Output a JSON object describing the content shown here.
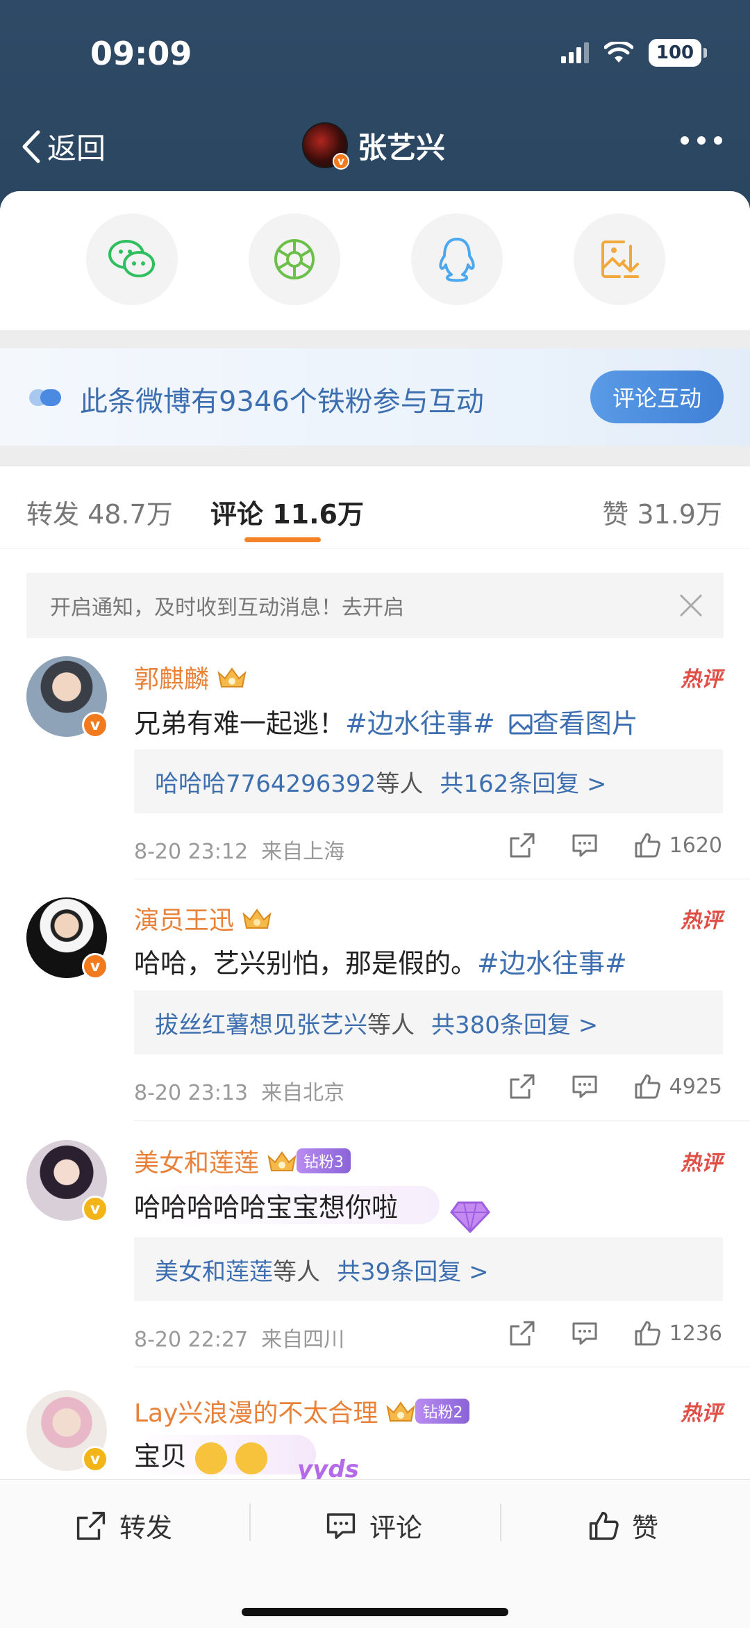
{
  "status_bar": {
    "time": "09:09",
    "battery": "100"
  },
  "nav": {
    "back_label": "返回",
    "title": "张艺兴"
  },
  "share_sheet": {
    "icons": [
      "wechat-icon",
      "moments-icon",
      "qq-icon",
      "save-image-icon"
    ]
  },
  "banner": {
    "text": "此条微博有9346个铁粉参与互动",
    "button": "评论互动"
  },
  "tabs": {
    "repost": "转发 48.7万",
    "comment": "评论 11.6万",
    "like": "赞 31.9万"
  },
  "notify": {
    "text": "开启通知，及时收到互动消息！去开启"
  },
  "comments": [
    {
      "name": "郭麒麟",
      "hot": "热评",
      "text": "兄弟有难一起逃！",
      "topic": "#边水往事#",
      "extra": "查看图片",
      "reply_users": "哈哈哈7764296392",
      "reply_mid": "等人",
      "reply_count": "共162条回复 >",
      "time": "8-20 23:12",
      "location": "来自上海",
      "likes": "1620"
    },
    {
      "name": "演员王迅",
      "hot": "热评",
      "text": "哈哈，艺兴别怕，那是假的。",
      "topic": "#边水往事#",
      "reply_users": "拔丝红薯想见张艺兴",
      "reply_mid": "等人",
      "reply_count": "共380条回复 >",
      "time": "8-20 23:13",
      "location": "来自北京",
      "likes": "4925"
    },
    {
      "name": "美女和莲莲",
      "fan_badge": "钻粉3",
      "hot": "热评",
      "text": "哈哈哈哈哈宝宝想你啦",
      "reply_users": "美女和莲莲",
      "reply_mid": "等人",
      "reply_count": "共39条回复 >",
      "time": "8-20 22:27",
      "location": "来自四川",
      "likes": "1236"
    },
    {
      "name": "Lay兴浪漫的不太合理",
      "fan_badge": "钻粉2",
      "hot": "热评",
      "text": "宝贝",
      "sticker": "yyds"
    }
  ],
  "bottom_bar": {
    "repost": "转发",
    "comment": "评论",
    "like": "赞"
  }
}
